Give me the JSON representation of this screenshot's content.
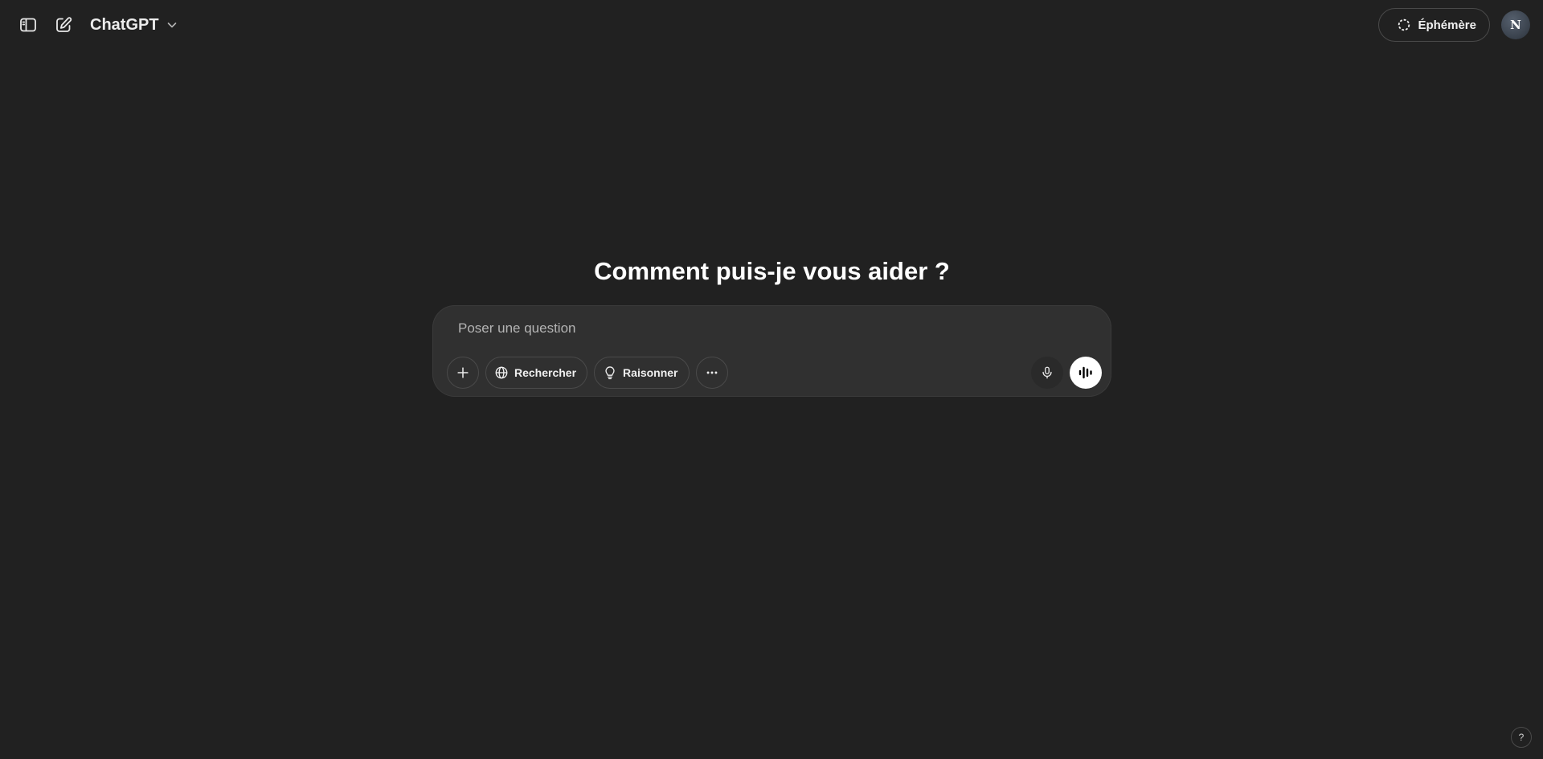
{
  "header": {
    "model_name": "ChatGPT",
    "ephemeral_label": "Éphémère",
    "avatar_initial": "N",
    "icons": {
      "sidebar_toggle": "sidebar-toggle-icon",
      "new_chat": "new-chat-pencil-icon",
      "model_dropdown": "chevron-down-icon",
      "ephemeral": "dashed-circle-icon"
    }
  },
  "main": {
    "headline": "Comment puis-je vous aider ?",
    "composer": {
      "placeholder": "Poser une question",
      "value": "",
      "tools": {
        "attach_icon": "plus-icon",
        "search_label": "Rechercher",
        "search_icon": "globe-icon",
        "reason_label": "Raisonner",
        "reason_icon": "lightbulb-icon",
        "more_icon": "more-dots-icon",
        "dictate_icon": "microphone-icon",
        "voice_icon": "voice-waveform-icon"
      }
    }
  },
  "footer": {
    "help_label": "?"
  },
  "colors": {
    "background": "#212121",
    "composer": "#303030",
    "text": "#ececec",
    "voice_button": "#ffffff"
  }
}
